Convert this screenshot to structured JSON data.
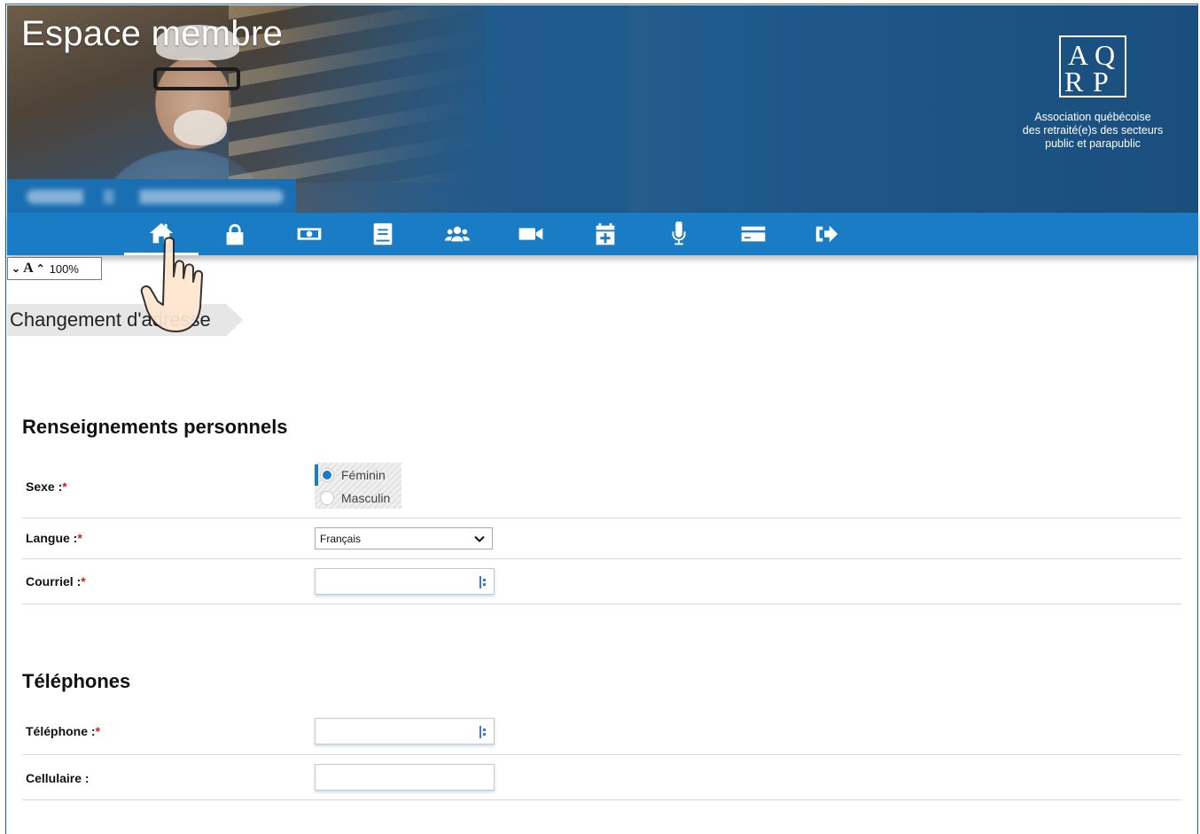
{
  "header": {
    "title": "Espace membre",
    "logo_letters": [
      "A",
      "Q",
      "R",
      "P"
    ],
    "logo_text": [
      "Association québécoise",
      "des retraité(e)s des secteurs",
      "public et parapublic"
    ]
  },
  "nav": {
    "items": [
      {
        "name": "home",
        "icon": "home-icon",
        "active": true
      },
      {
        "name": "lock",
        "icon": "lock-icon"
      },
      {
        "name": "money",
        "icon": "money-icon"
      },
      {
        "name": "book",
        "icon": "book-icon"
      },
      {
        "name": "group",
        "icon": "users-icon"
      },
      {
        "name": "video",
        "icon": "video-camera-icon"
      },
      {
        "name": "calendar",
        "icon": "calendar-plus-icon"
      },
      {
        "name": "microphone",
        "icon": "microphone-icon"
      },
      {
        "name": "card",
        "icon": "credit-card-icon"
      },
      {
        "name": "logout",
        "icon": "sign-out-icon"
      }
    ],
    "accent_color": "#1a7cc4"
  },
  "font_control": {
    "down": "⌄",
    "letter": "A",
    "up": "⌃",
    "zoom": "100%"
  },
  "breadcrumb": {
    "label": "Changement d'adresse"
  },
  "personal": {
    "title": "Renseignements personnels",
    "sexe_label": "Sexe :",
    "sexe_options": [
      "Féminin",
      "Masculin"
    ],
    "sexe_selected": "Féminin",
    "langue_label": "Langue :",
    "langue_value": "Français",
    "courriel_label": "Courriel :"
  },
  "phones": {
    "title": "Téléphones",
    "telephone_label": "Téléphone :",
    "cellulaire_label": "Cellulaire :"
  },
  "required_marker": "*"
}
